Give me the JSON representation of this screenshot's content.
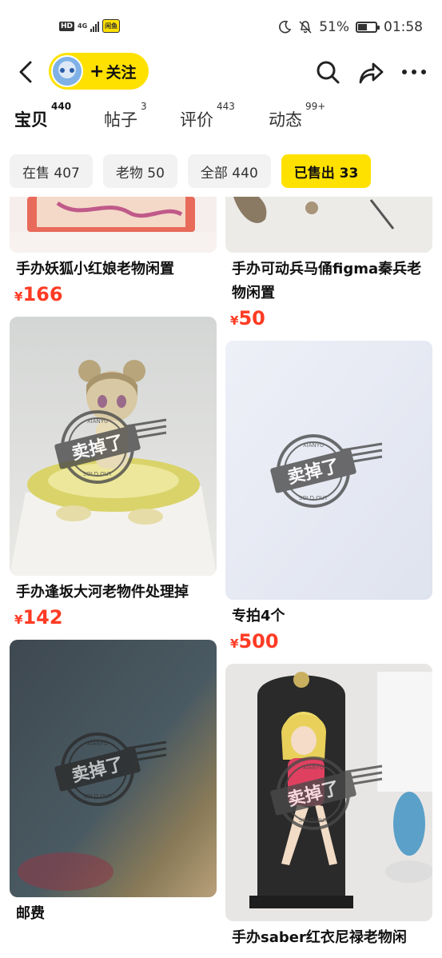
{
  "status_bar": {
    "hd": "HD",
    "network": "4G",
    "app_badge": "闲鱼",
    "battery": "51%",
    "battery_level": 0.51,
    "time": "01:58"
  },
  "header": {
    "follow_plus": "+",
    "follow_label": "关注"
  },
  "tabs": [
    {
      "label": "宝贝",
      "count": "440"
    },
    {
      "label": "帖子",
      "count": "3"
    },
    {
      "label": "评价",
      "count": "443"
    },
    {
      "label": "动态",
      "count": "99+"
    }
  ],
  "filters": [
    {
      "label": "在售 407"
    },
    {
      "label": "老物 50"
    },
    {
      "label": "全部 440"
    },
    {
      "label": "已售出 33"
    }
  ],
  "stamp": {
    "text": "卖掉了",
    "top": "XIANYU",
    "bottom": "SOLD OUT"
  },
  "items": [
    {
      "title": "手办妖狐小红娘老物闲置",
      "currency": "¥",
      "price": "166"
    },
    {
      "title": "手办可动兵马俑figma秦兵老物闲置",
      "currency": "¥",
      "price": "50"
    },
    {
      "title": "手办逢坂大河老物件处理掉",
      "currency": "¥",
      "price": "142"
    },
    {
      "title": "专拍4个",
      "currency": "¥",
      "price": "500"
    },
    {
      "title": "邮费",
      "currency": "¥",
      "price": ""
    },
    {
      "title": "手办saber红衣尼禄老物闲",
      "currency": "¥",
      "price": ""
    }
  ],
  "colors": {
    "accent": "#ffe100",
    "price": "#ff3b24"
  }
}
